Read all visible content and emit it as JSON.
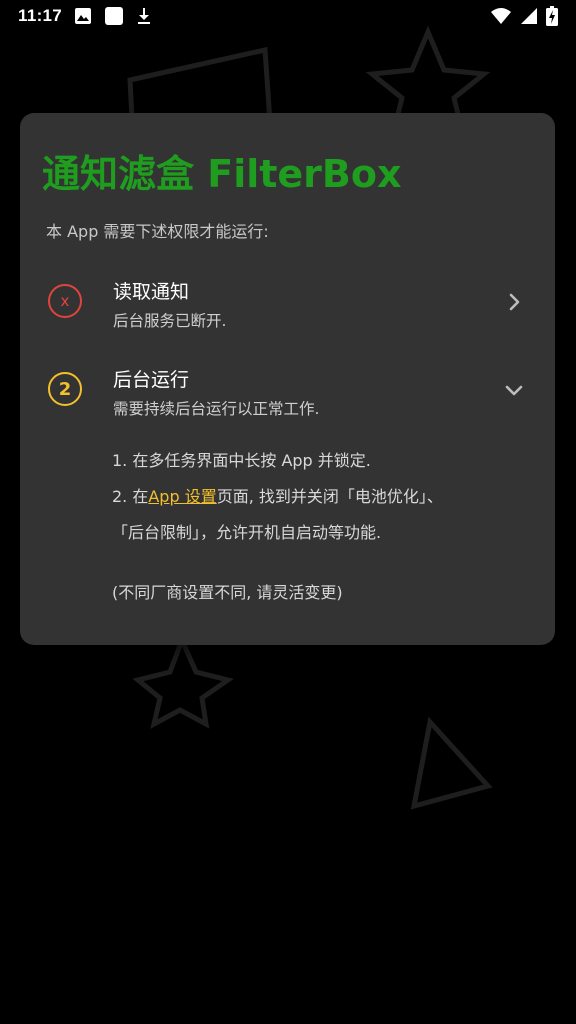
{
  "status_bar": {
    "time": "11:17",
    "left_icons": [
      "image-icon",
      "square-icon",
      "download-icon"
    ],
    "right_icons": [
      "wifi-icon",
      "signal-icon",
      "battery-charging-icon"
    ]
  },
  "dialog": {
    "title": "通知滤盒 FilterBox",
    "subtitle": "本 App 需要下述权限才能运行:",
    "permissions": [
      {
        "badge": "x",
        "status": "error",
        "title": "读取通知",
        "description": "后台服务已断开.",
        "arrow": "chevron-right-icon"
      },
      {
        "badge": "2",
        "status": "warning",
        "title": "后台运行",
        "description": "需要持续后台运行以正常工作.",
        "arrow": "chevron-down-icon"
      }
    ],
    "steps": {
      "step1": "1. 在多任务界面中长按 App 并锁定.",
      "step2_prefix": "2. 在",
      "step2_link": "App 设置",
      "step2_suffix": "页面, 找到并关闭「电池优化」、",
      "step2_line2": "「后台限制」，允许开机自启动等功能.",
      "note": "(不同厂商设置不同, 请灵活变更)"
    }
  },
  "colors": {
    "title_green": "#1f9d1f",
    "error_red": "#e0443e",
    "warning_yellow": "#f2c02c",
    "card_bg": "#333333",
    "background": "#000000"
  }
}
